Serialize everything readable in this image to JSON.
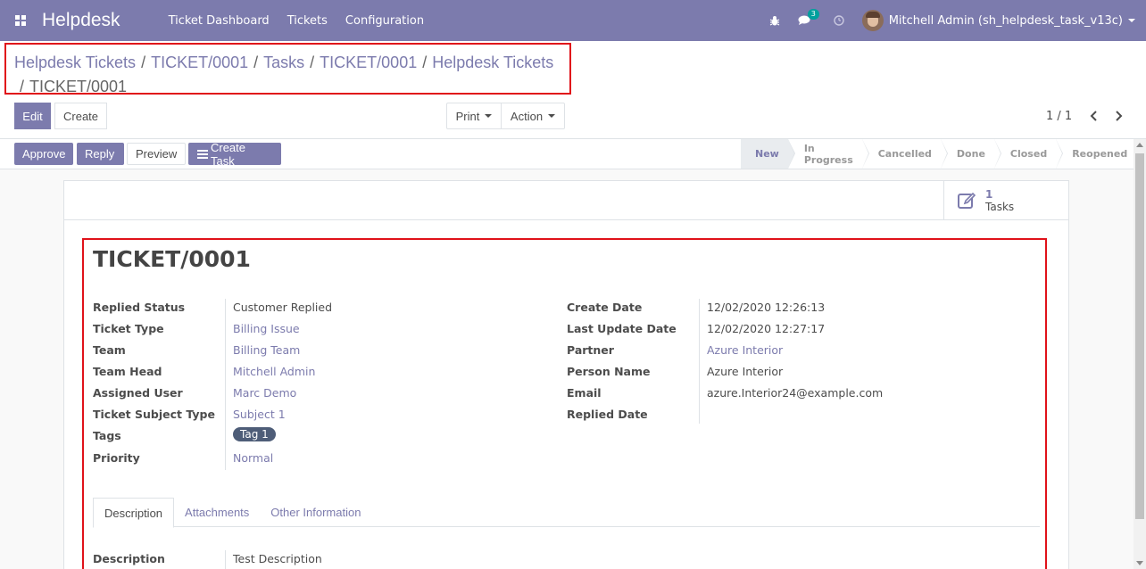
{
  "navbar": {
    "brand": "Helpdesk",
    "menu": [
      "Ticket Dashboard",
      "Tickets",
      "Configuration"
    ],
    "message_count": "3",
    "user_name": "Mitchell Admin (sh_helpdesk_task_v13c)"
  },
  "breadcrumb": {
    "items": [
      "Helpdesk Tickets",
      "TICKET/0001",
      "Tasks",
      "TICKET/0001",
      "Helpdesk Tickets"
    ],
    "active": "TICKET/0001",
    "separator": "/"
  },
  "control": {
    "edit_label": "Edit",
    "create_label": "Create",
    "print_label": "Print",
    "action_label": "Action",
    "pager": "1 / 1"
  },
  "statusbar": {
    "buttons": [
      "Approve",
      "Reply",
      "Preview",
      "Create Task"
    ],
    "stages": [
      "New",
      "In Progress",
      "Cancelled",
      "Done",
      "Closed",
      "Reopened"
    ],
    "current_stage": "New"
  },
  "smart_button": {
    "count": "1",
    "label": "Tasks"
  },
  "form": {
    "title": "TICKET/0001",
    "left_fields": [
      {
        "label": "Replied Status",
        "value": "Customer Replied",
        "link": false
      },
      {
        "label": "Ticket Type",
        "value": "Billing Issue",
        "link": true
      },
      {
        "label": "Team",
        "value": "Billing Team",
        "link": true
      },
      {
        "label": "Team Head",
        "value": "Mitchell Admin",
        "link": true
      },
      {
        "label": "Assigned User",
        "value": "Marc Demo",
        "link": true
      },
      {
        "label": "Ticket Subject Type",
        "value": "Subject 1",
        "link": true
      },
      {
        "label": "Tags",
        "value": "Tag 1",
        "link": false
      },
      {
        "label": "Priority",
        "value": "Normal",
        "link": true
      }
    ],
    "right_fields": [
      {
        "label": "Create Date",
        "value": "12/02/2020 12:26:13",
        "link": false
      },
      {
        "label": "Last Update Date",
        "value": "12/02/2020 12:27:17",
        "link": false
      },
      {
        "label": "Partner",
        "value": "Azure Interior",
        "link": true
      },
      {
        "label": "Person Name",
        "value": "Azure Interior",
        "link": false
      },
      {
        "label": "Email",
        "value": "azure.Interior24@example.com",
        "link": false
      },
      {
        "label": "Replied Date",
        "value": "",
        "link": false
      }
    ],
    "tabs": [
      "Description",
      "Attachments",
      "Other Information"
    ],
    "active_tab": "Description",
    "description_label": "Description",
    "description_value": "Test Description"
  },
  "colors": {
    "brand": "#7c7bad",
    "highlight": "#e0121a",
    "tag_bg": "#4e5d78"
  }
}
